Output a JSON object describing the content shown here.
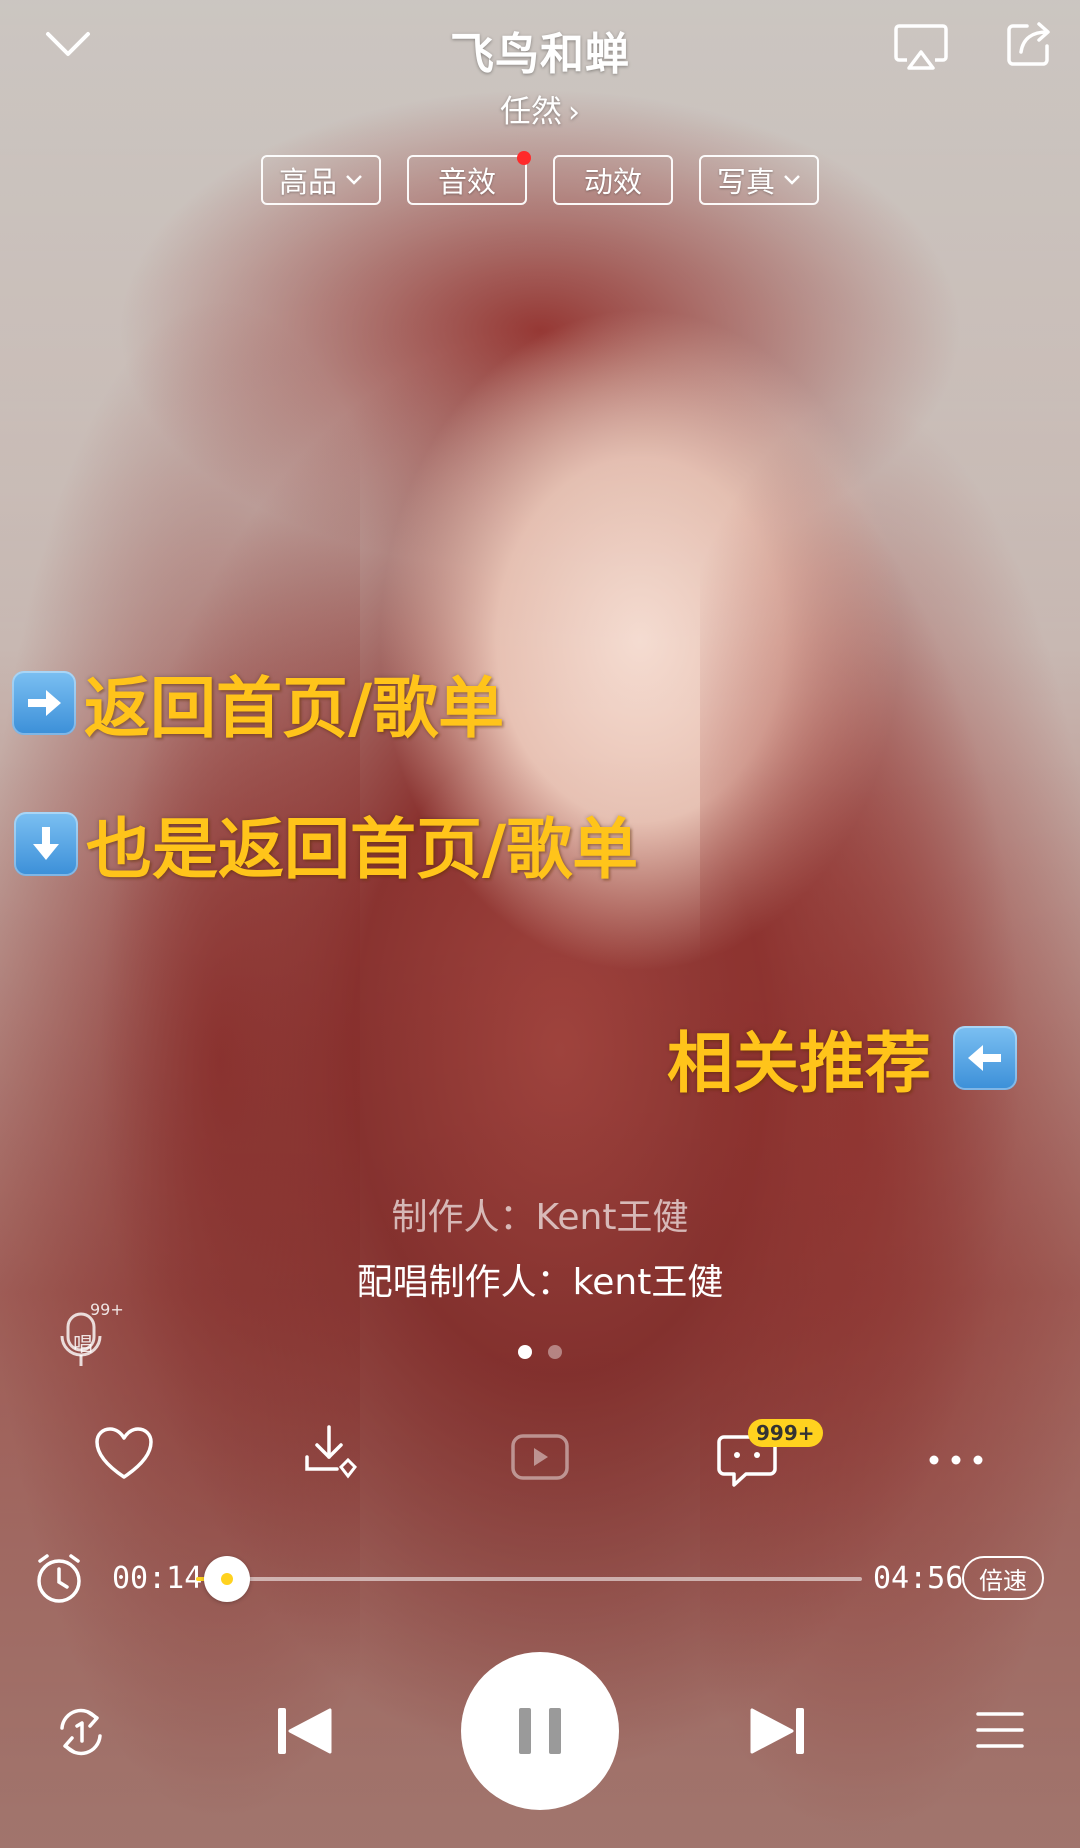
{
  "header": {
    "song_title": "飞鸟和蝉",
    "artist": "任然",
    "artist_chevron": "›"
  },
  "chips": [
    {
      "label": "高品",
      "has_caret": true
    },
    {
      "label": "音效",
      "has_dot": true
    },
    {
      "label": "动效"
    },
    {
      "label": "写真",
      "has_caret": true
    }
  ],
  "annotations": {
    "a1": "返回首页/歌单",
    "a2": "也是返回首页/歌单",
    "a3": "相关推荐"
  },
  "credits": {
    "line1": "制作人：Kent王健",
    "line2": "配唱制作人：kent王健"
  },
  "sing_badge": "99+",
  "sing_label": "唱",
  "comment_badge": "999+",
  "player": {
    "elapsed": "00:14",
    "total": "04:56",
    "progress_fraction": 0.047,
    "speed_label": "倍速"
  },
  "colors": {
    "accent": "#ffd21f",
    "annotation": "#ffc41a"
  },
  "icons": [
    "collapse-chevron-icon",
    "cast-icon",
    "share-icon",
    "arrow-right-emoji-icon",
    "arrow-down-emoji-icon",
    "arrow-left-emoji-icon",
    "sing-mic-icon",
    "heart-icon",
    "download-icon",
    "video-icon",
    "comment-icon",
    "more-icon",
    "timer-icon",
    "repeat-one-icon",
    "previous-icon",
    "pause-icon",
    "next-icon",
    "playlist-icon"
  ]
}
